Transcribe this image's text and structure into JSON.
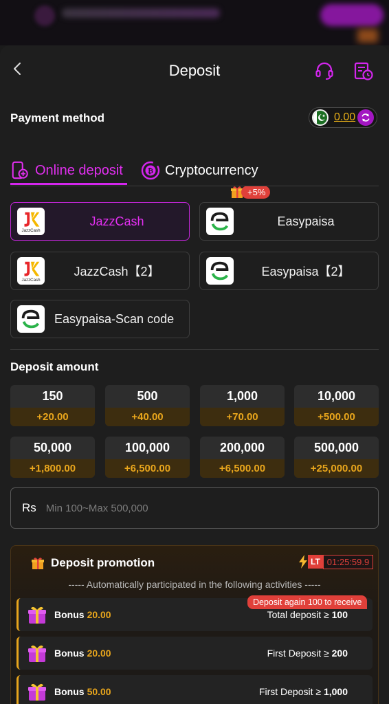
{
  "header": {
    "title": "Deposit"
  },
  "payment_method": {
    "label": "Payment method",
    "balance": "0.00",
    "tabs": [
      {
        "label": "Online deposit",
        "active": true
      },
      {
        "label": "Cryptocurrency",
        "active": false,
        "badge": "+5%"
      }
    ],
    "methods": [
      {
        "label": "JazzCash",
        "active": true
      },
      {
        "label": "Easypaisa",
        "active": false
      },
      {
        "label": "JazzCash【2】",
        "active": false
      },
      {
        "label": "Easypaisa【2】",
        "active": false
      },
      {
        "label": "Easypaisa-Scan code",
        "active": false
      }
    ]
  },
  "deposit_amount": {
    "label": "Deposit amount",
    "options": [
      {
        "value": "150",
        "bonus": "+20.00"
      },
      {
        "value": "500",
        "bonus": "+40.00"
      },
      {
        "value": "1,000",
        "bonus": "+70.00"
      },
      {
        "value": "10,000",
        "bonus": "+500.00"
      },
      {
        "value": "50,000",
        "bonus": "+1,800.00"
      },
      {
        "value": "100,000",
        "bonus": "+6,500.00"
      },
      {
        "value": "200,000",
        "bonus": "+6,500.00"
      },
      {
        "value": "500,000",
        "bonus": "+25,000.00"
      }
    ],
    "currency": "Rs",
    "placeholder": "Min 100~Max 500,000"
  },
  "promotion": {
    "title": "Deposit promotion",
    "lt_label": "LT",
    "timer": "01:25:59.9",
    "subtitle": "----- Automatically participated in the following activities -----",
    "tip": "Deposit again 100 to receive",
    "rows": [
      {
        "label": "Bonus",
        "value": "20.00",
        "condition": "Total deposit ≥",
        "condition_value": "100"
      },
      {
        "label": "Bonus",
        "value": "20.00",
        "condition": "First Deposit ≥",
        "condition_value": "200"
      },
      {
        "label": "Bonus",
        "value": "50.00",
        "condition": "First Deposit ≥",
        "condition_value": "1,000"
      }
    ]
  },
  "colors": {
    "accent": "#e22ff0",
    "gold": "#e9a61c",
    "alert": "#e0403a",
    "background": "#1e1e1e"
  },
  "icons": [
    "back-arrow-icon",
    "headset-icon",
    "history-icon",
    "pakistan-flag-icon",
    "refresh-icon",
    "phone-deposit-icon",
    "crypto-coin-icon",
    "gift-icon",
    "lightning-icon",
    "jazzcash-logo",
    "easypaisa-logo"
  ]
}
